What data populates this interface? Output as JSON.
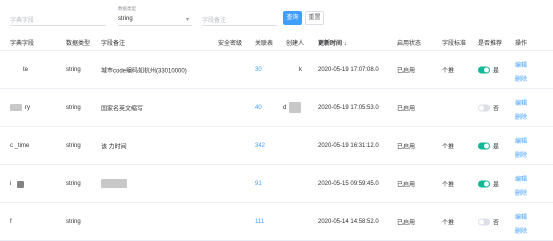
{
  "filters": {
    "field_name_placeholder": "字典字段",
    "data_type_label": "数据类型",
    "data_type_value": "string",
    "field_remark_placeholder": "字段备注",
    "query_label": "查询",
    "reset_label": "重置"
  },
  "table": {
    "headers": {
      "field": "字典字段",
      "data_type": "数据类型",
      "remark": "字段备注",
      "security_level": "安全密级",
      "related_tables": "关联表",
      "creator": "创建人",
      "updated_at": "更新时间 ↓",
      "status": "启用状态",
      "standard": "字段标准",
      "recommended": "是否推荐",
      "operations": "操作"
    },
    "rows": [
      {
        "field": "te",
        "data_type": "string",
        "remark": "城市code编码如杭州(33010000)",
        "related_tables": "30",
        "creator": "k",
        "updated_at": "2020-05-19 17:07:08.0",
        "status": "已启用",
        "standard": "个推",
        "recommended_on": true,
        "recommended_label": "是",
        "edit": "编辑",
        "delete": "删除"
      },
      {
        "field": "ry",
        "data_type": "string",
        "remark": "国家名英文缩写",
        "related_tables": "40",
        "creator": "d",
        "updated_at": "2020-05-19 17:05:53.0",
        "status": "已启用",
        "standard": "",
        "recommended_on": false,
        "recommended_label": "否",
        "edit": "编辑",
        "delete": "删除"
      },
      {
        "field": "c   _time",
        "data_type": "string",
        "remark": "该                力时间",
        "related_tables": "342",
        "creator": "",
        "updated_at": "2020-05-19 16:31:12.0",
        "status": "已启用",
        "standard": "个推",
        "recommended_on": true,
        "recommended_label": "是",
        "edit": "编辑",
        "delete": "删除"
      },
      {
        "field": "i",
        "data_type": "string",
        "remark": "",
        "related_tables": "91",
        "creator": "",
        "updated_at": "2020-05-15 09:59:45.0",
        "status": "已启用",
        "standard": "个推",
        "recommended_on": true,
        "recommended_label": "是",
        "edit": "编辑",
        "delete": "删除"
      },
      {
        "field": "f",
        "data_type": "string",
        "remark": "",
        "related_tables": "111",
        "creator": "",
        "updated_at": "2020-05-14 14:58:52.0",
        "status": "已启用",
        "standard": "个推",
        "recommended_on": false,
        "recommended_label": "否",
        "edit": "编辑",
        "delete": "删除"
      }
    ]
  },
  "colors": {
    "accent": "#409eff",
    "switch_on": "#13b996",
    "switch_off": "#dcdfe6"
  }
}
